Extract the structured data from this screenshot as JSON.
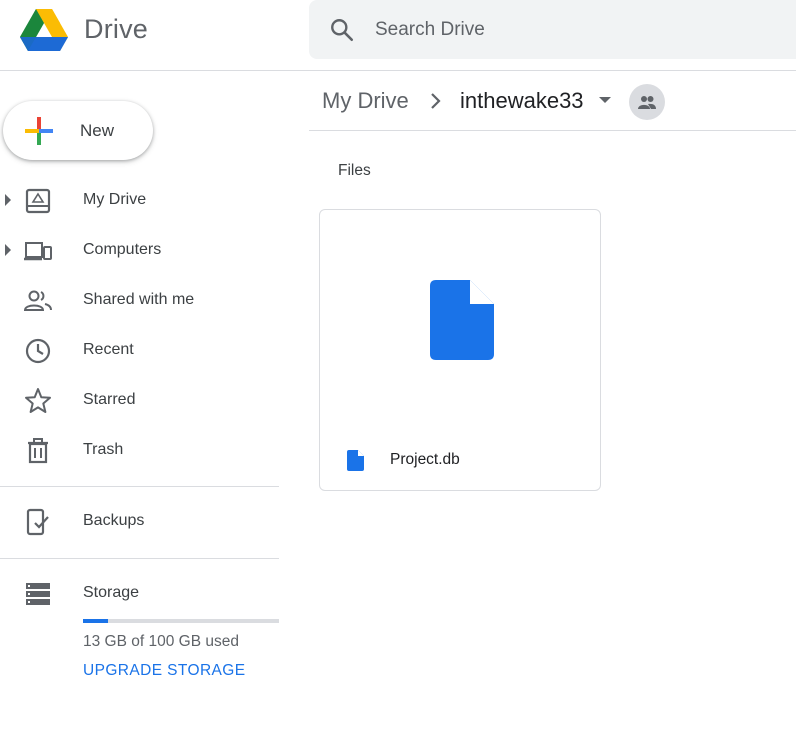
{
  "header": {
    "app_name": "Drive",
    "logo_icon": "google-drive-logo",
    "search": {
      "placeholder": "Search Drive",
      "value": ""
    }
  },
  "sidebar": {
    "new_button": {
      "label": "New",
      "icon": "plus-icon"
    },
    "items": [
      {
        "label": "My Drive",
        "icon": "my-drive-icon",
        "expandable": true
      },
      {
        "label": "Computers",
        "icon": "computers-icon",
        "expandable": true
      },
      {
        "label": "Shared with me",
        "icon": "people-icon",
        "expandable": false
      },
      {
        "label": "Recent",
        "icon": "clock-icon",
        "expandable": false
      },
      {
        "label": "Starred",
        "icon": "star-icon",
        "expandable": false
      },
      {
        "label": "Trash",
        "icon": "trash-icon",
        "expandable": false
      }
    ],
    "backups": {
      "label": "Backups",
      "icon": "backup-phone-icon"
    },
    "storage": {
      "label": "Storage",
      "icon": "storage-icon",
      "used_text": "13 GB of 100 GB used",
      "used_fraction": 0.13,
      "upgrade_label": "UPGRADE STORAGE"
    }
  },
  "breadcrumb": {
    "root": "My Drive",
    "current": "inthewake33",
    "shared_icon": "shared-folder-people-icon"
  },
  "main": {
    "section_label": "Files",
    "files": [
      {
        "name": "Project.db",
        "icon": "file-icon"
      }
    ]
  },
  "colors": {
    "accent": "#1a73e8",
    "text": "#3c4043",
    "muted": "#5f6368",
    "border": "#dadce0",
    "search_bg": "#f1f3f4"
  }
}
